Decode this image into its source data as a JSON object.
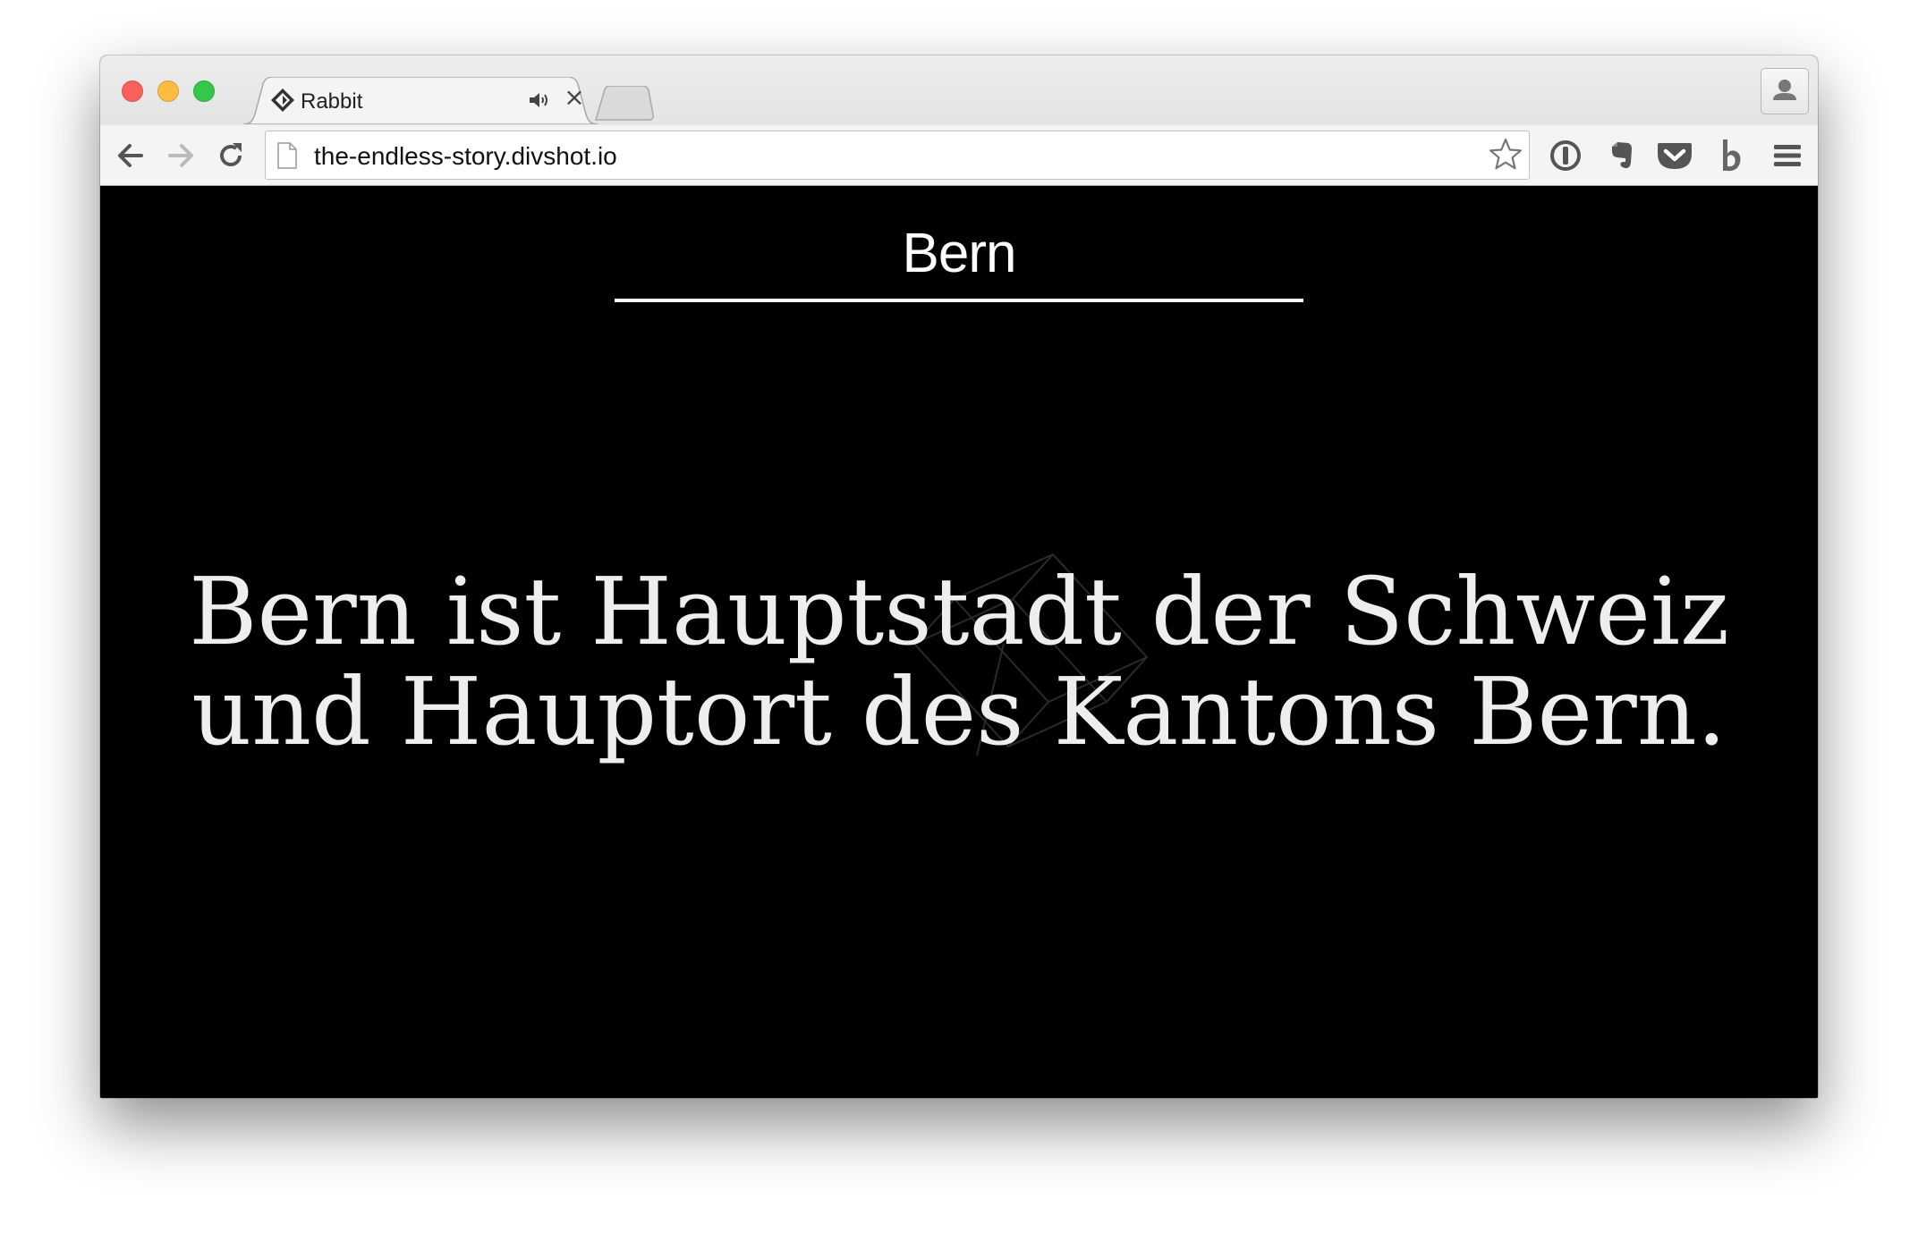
{
  "browser": {
    "tab": {
      "title": "Rabbit",
      "close_glyph": "×",
      "favicon_icon": "diamond-logo-icon",
      "audio_icon": "speaker-icon"
    },
    "address_bar": {
      "url": "the-endless-story.divshot.io"
    },
    "toolbar_icons": [
      "back-arrow-icon",
      "forward-arrow-icon",
      "reload-icon",
      "bookmark-star-icon",
      "onepassword-icon",
      "evernote-icon",
      "pocket-icon",
      "b-extension-icon",
      "menu-icon"
    ]
  },
  "page": {
    "title": "Bern",
    "headline": "Bern ist Hauptstadt der Schweiz und Hauptort des Kantons Bern."
  },
  "colors": {
    "page_background": "#000000",
    "text": "#ffffff",
    "close": "#fc605c",
    "minimize": "#fdbc40",
    "maximize": "#34c84a"
  }
}
